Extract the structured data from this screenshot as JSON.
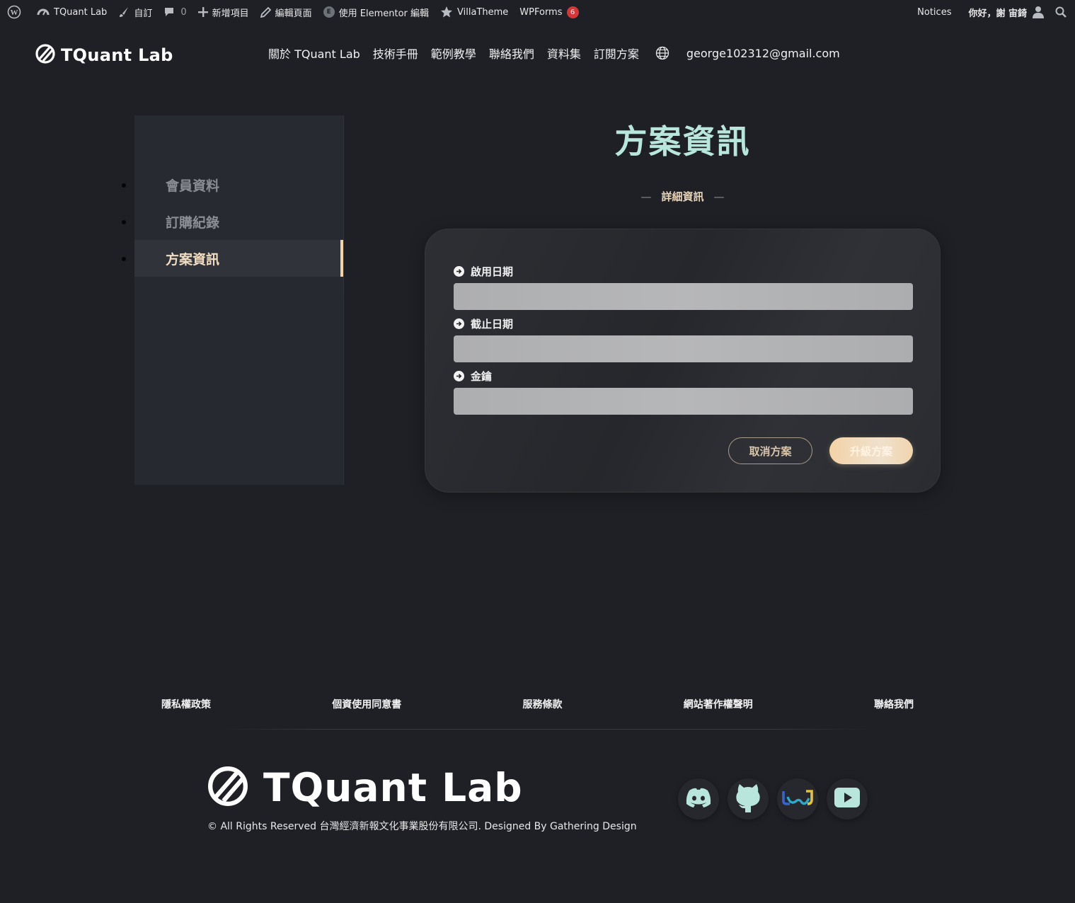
{
  "admin_bar": {
    "site_name": "TQuant Lab",
    "customize": "自訂",
    "comments_count": "0",
    "new_item": "新增項目",
    "edit_page": "編輯頁面",
    "elementor_edit": "使用 Elementor 編輯",
    "villatheme": "VillaTheme",
    "wpforms": "WPForms",
    "wpforms_badge": "6",
    "notices": "Notices",
    "greeting": "你好，謝 宙錡"
  },
  "header": {
    "logo_text": "TQuant Lab",
    "nav": [
      "關於 TQuant Lab",
      "技術手冊",
      "範例教學",
      "聯絡我們",
      "資料集",
      "訂閱方案"
    ],
    "email": "george102312@gmail.com"
  },
  "sidebar": {
    "items": [
      {
        "label": "會員資料"
      },
      {
        "label": "訂購紀錄"
      },
      {
        "label": "方案資訊"
      }
    ],
    "active_index": 2
  },
  "main": {
    "title": "方案資訊",
    "subtitle": "詳細資訊",
    "fields": [
      {
        "label": "啟用日期",
        "value": ""
      },
      {
        "label": "截止日期",
        "value": ""
      },
      {
        "label": "金鑰",
        "value": ""
      }
    ],
    "cancel_button": "取消方案",
    "upgrade_button": "升級方案"
  },
  "footer": {
    "links": [
      "隱私權政策",
      "個資使用同意書",
      "服務條款",
      "網站著作權聲明",
      "聯絡我們"
    ],
    "logo_text": "TQuant Lab",
    "copyright": "© All Rights Reserved 台灣經濟新報文化事業股份有限公司. Designed By Gathering Design",
    "socials": [
      "discord-icon",
      "github-icon",
      "tej-icon",
      "youtube-icon"
    ]
  },
  "colors": {
    "background": "#1e2026",
    "accent_gold": "#f2d4a8",
    "title_mint": "#b9e6dc",
    "social_icon": "#b9e6dc",
    "badge_red": "#d63638"
  }
}
